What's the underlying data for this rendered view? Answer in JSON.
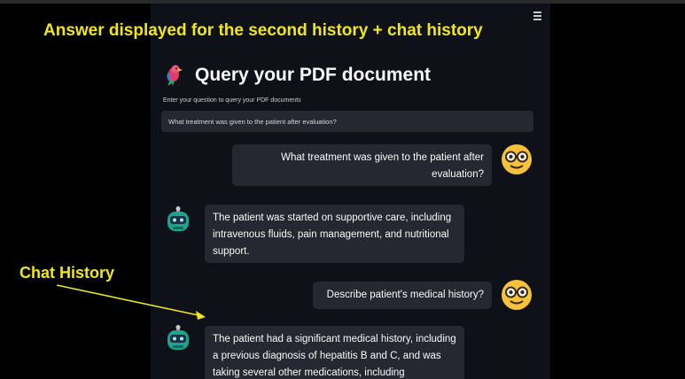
{
  "annotations": {
    "title": "Answer displayed for the second history + chat history",
    "side_label": "Chat History"
  },
  "app": {
    "title": "Query your PDF document",
    "input_label": "Enter your question to query your PDF documents",
    "input_value": "What treatment was given to the patient after evaluation?"
  },
  "messages": [
    {
      "role": "user",
      "avatar": "nerd-face-icon",
      "text": "What treatment was given to the patient after evaluation?"
    },
    {
      "role": "bot",
      "avatar": "robot-icon",
      "text": "The patient was started on supportive care, including intravenous fluids, pain management, and nutritional support."
    },
    {
      "role": "user",
      "avatar": "nerd-face-icon",
      "text": "Describe patient's medical history?"
    },
    {
      "role": "bot",
      "avatar": "robot-icon",
      "text": "The patient had a significant medical history, including a previous diagnosis of hepatitis B and C, and was taking several other medications, including"
    }
  ],
  "colors": {
    "background": "#000000",
    "panel": "#0e1117",
    "bubble": "#262730",
    "annotation": "#f0e61e"
  }
}
